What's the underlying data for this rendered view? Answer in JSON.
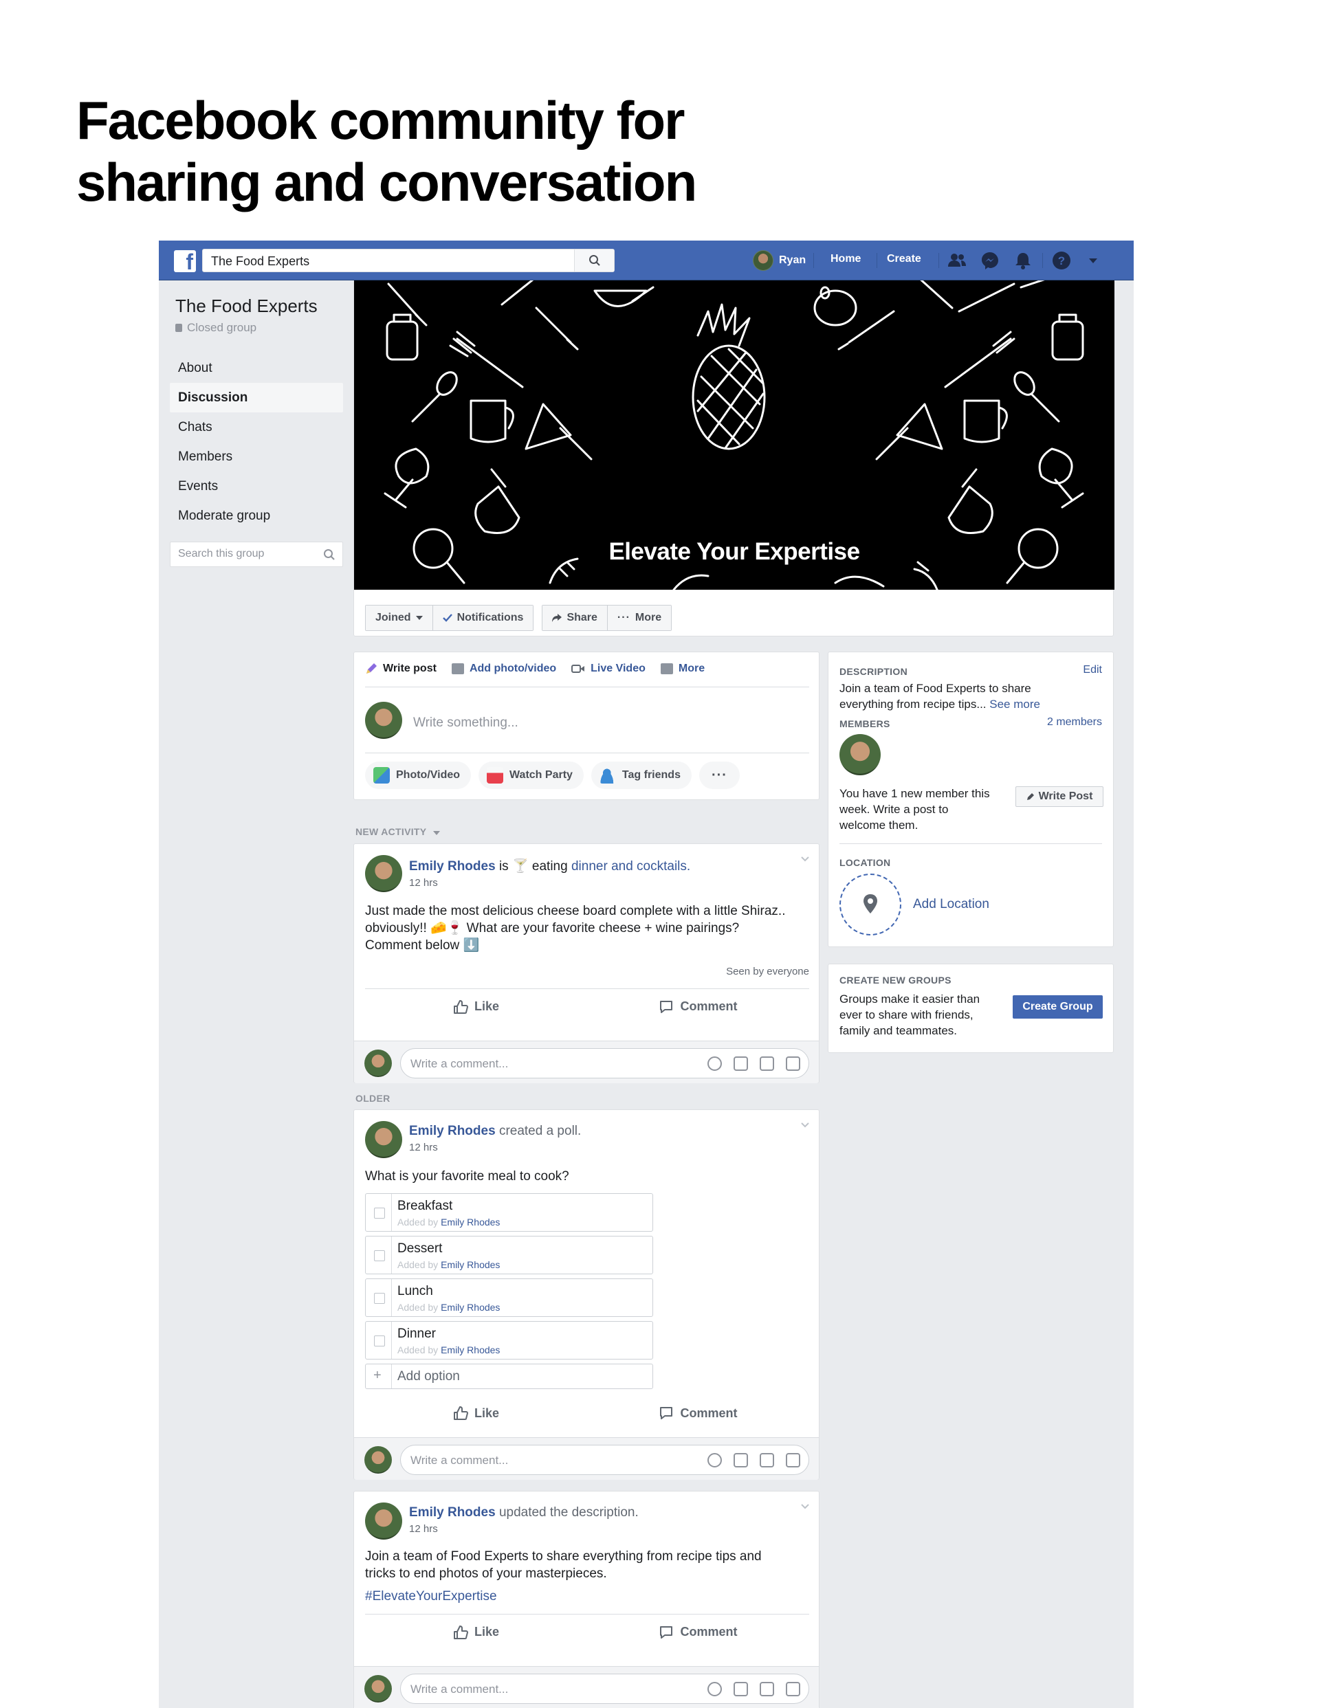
{
  "headline": {
    "line1": "Facebook community for",
    "line2": "sharing and conversation"
  },
  "topbar": {
    "search_value": "The Food Experts",
    "user_name": "Ryan",
    "home": "Home",
    "create": "Create"
  },
  "sidebar": {
    "group_name": "The Food Experts",
    "privacy": "Closed group",
    "items": [
      {
        "label": "About"
      },
      {
        "label": "Discussion"
      },
      {
        "label": "Chats"
      },
      {
        "label": "Members"
      },
      {
        "label": "Events"
      },
      {
        "label": "Moderate group"
      }
    ],
    "search_placeholder": "Search this group"
  },
  "cover": {
    "title": "Elevate Your Expertise",
    "buttons": {
      "joined": "Joined",
      "notifications": "Notifications",
      "share": "Share",
      "more": "More"
    }
  },
  "composer": {
    "tabs": {
      "write": "Write post",
      "photo": "Add photo/video",
      "live": "Live Video",
      "more": "More"
    },
    "placeholder": "Write something...",
    "pills": {
      "photo": "Photo/Video",
      "watch": "Watch Party",
      "tag": "Tag friends"
    }
  },
  "sections": {
    "new_activity": "NEW ACTIVITY",
    "older": "OLDER"
  },
  "post1": {
    "author": "Emily Rhodes",
    "verb": "is",
    "activity": "eating",
    "activity_target": "dinner and cocktails.",
    "time": "12 hrs",
    "body_line1": "Just made the most delicious cheese board complete with a little Shiraz..",
    "body_line2": "obviously!! 🧀🍷 What are your favorite cheese + wine pairings?",
    "body_line3": "Comment below ⬇️",
    "seen": "Seen by everyone"
  },
  "post2": {
    "author": "Emily Rhodes",
    "action": "created a poll.",
    "time": "12 hrs",
    "question": "What is your favorite meal to cook?",
    "added_by_prefix": "Added by",
    "added_by_name": "Emily Rhodes",
    "options": [
      {
        "label": "Breakfast"
      },
      {
        "label": "Dessert"
      },
      {
        "label": "Lunch"
      },
      {
        "label": "Dinner"
      }
    ],
    "add_option": "Add option"
  },
  "post3": {
    "author": "Emily Rhodes",
    "action": "updated the description.",
    "time": "12 hrs",
    "body_line1": "Join a team of Food Experts to share everything from recipe tips and",
    "body_line2": "tricks to end photos of your masterpieces.",
    "hashtag": "#ElevateYourExpertise"
  },
  "actions": {
    "like": "Like",
    "comment": "Comment",
    "comment_placeholder": "Write a comment..."
  },
  "right": {
    "description_label": "DESCRIPTION",
    "edit": "Edit",
    "description_line1": "Join a team of Food Experts to share",
    "description_line2": "everything from recipe tips...",
    "see_more": "See more",
    "members_label": "MEMBERS",
    "members_count": "2 members",
    "new_member_line1": "You have 1 new member this",
    "new_member_line2": "week. Write a post to",
    "new_member_line3": "welcome them.",
    "write_post": "Write Post",
    "location_label": "LOCATION",
    "add_location": "Add Location",
    "create_groups_label": "CREATE NEW GROUPS",
    "create_groups_line1": "Groups make it easier than",
    "create_groups_line2": "ever to share with friends,",
    "create_groups_line3": "family and teammates.",
    "create_group_button": "Create Group"
  },
  "colors": {
    "brand": "#4267b2",
    "link": "#385898",
    "page_bg": "#e9ebee"
  }
}
